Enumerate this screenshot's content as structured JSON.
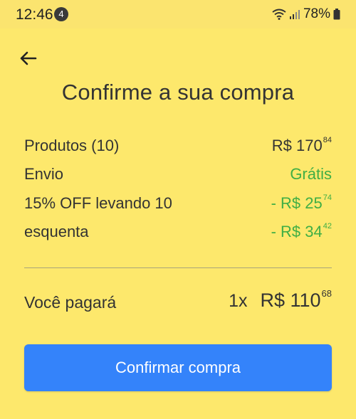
{
  "status_bar": {
    "time": "12:46",
    "notification_count": "4",
    "battery_percent": "78%"
  },
  "page": {
    "title": "Confirme a sua compra"
  },
  "summary": {
    "rows": [
      {
        "label": "Produtos (10)",
        "value_main": "R$ 170",
        "value_cents": "84",
        "value_color": "#333333"
      },
      {
        "label": "Envio",
        "value_main": "Grátis",
        "value_cents": "",
        "value_color": "#3fae45"
      },
      {
        "label": "15% OFF levando 10",
        "value_main": "- R$ 25",
        "value_cents": "74",
        "value_color": "#3fae45"
      },
      {
        "label": "esquenta",
        "value_main": "- R$ 34",
        "value_cents": "42",
        "value_color": "#3fae45"
      }
    ]
  },
  "total": {
    "label": "Você pagará",
    "installments": "1x",
    "amount_main": "R$ 110",
    "amount_cents": "68"
  },
  "actions": {
    "confirm_label": "Confirmar compra"
  },
  "colors": {
    "background": "#fde86c",
    "accent_button": "#3483fa",
    "discount_green": "#3fae45"
  }
}
